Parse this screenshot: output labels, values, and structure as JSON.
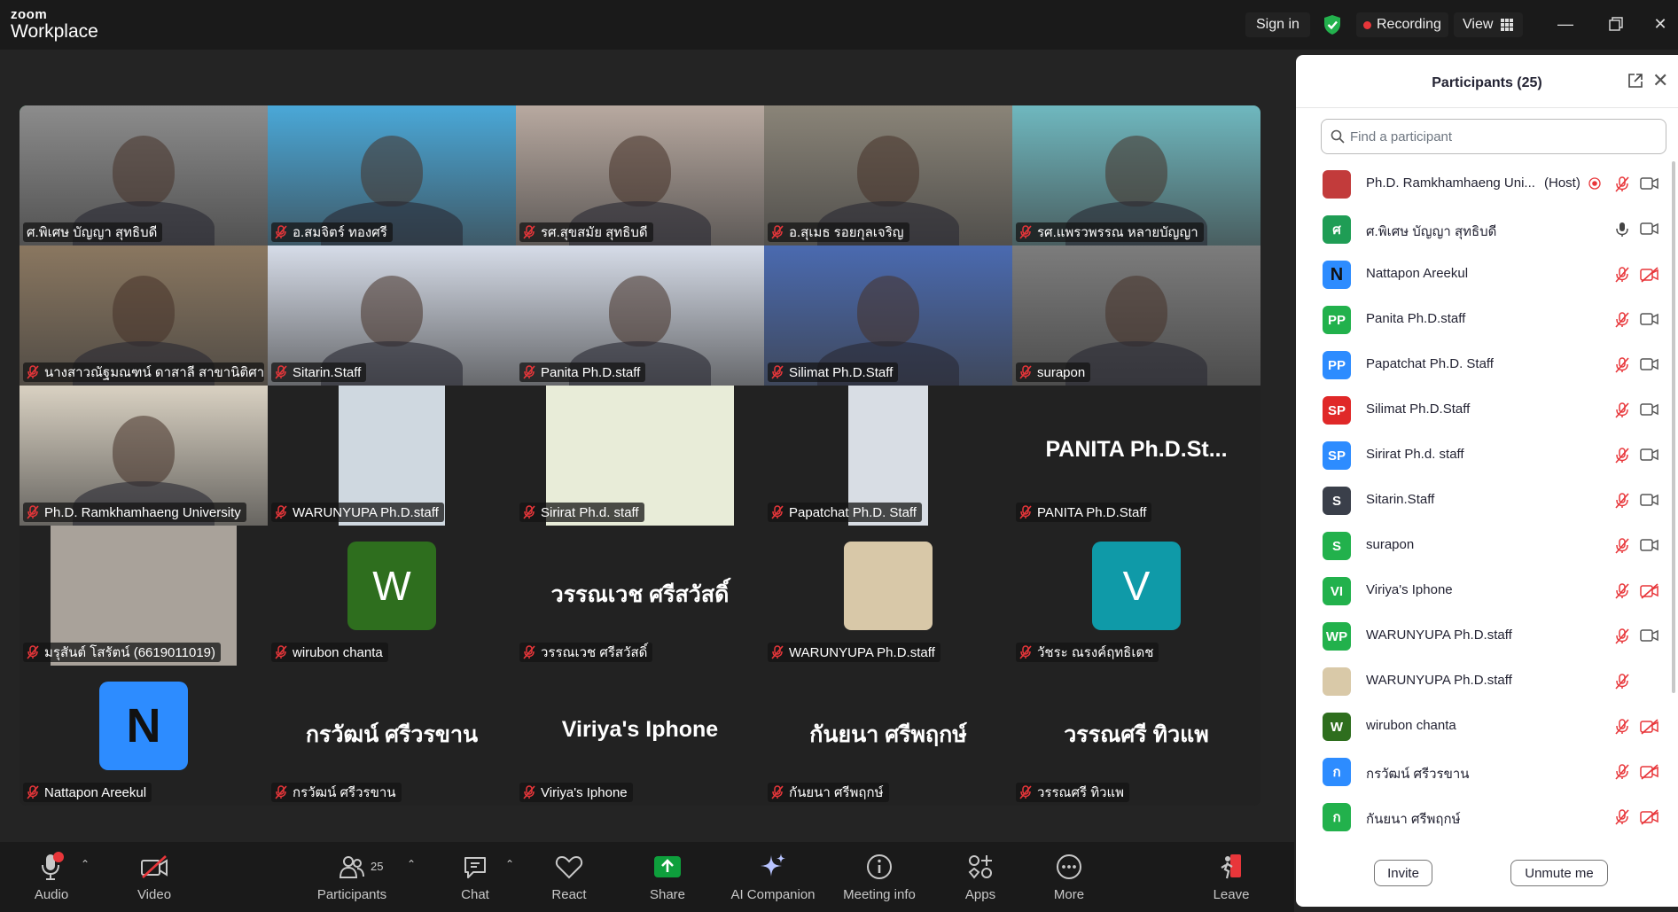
{
  "app": {
    "brand_top": "zoom",
    "brand_bottom": "Workplace"
  },
  "titlebar": {
    "sign_in": "Sign in",
    "recording": "Recording",
    "view": "View"
  },
  "grid": {
    "tiles": [
      {
        "label": "ศ.พิเศษ บัญญา สุทธิบดี",
        "muted": false,
        "active": true,
        "bg": "#8c8c8c",
        "kind": "video"
      },
      {
        "label": "อ.สมจิตร์ ทองศรี",
        "muted": true,
        "bg": "#4aa8d8",
        "kind": "video"
      },
      {
        "label": "รศ.สุขสมัย สุทธิบดี",
        "muted": true,
        "bg": "#b8a9a0",
        "kind": "video"
      },
      {
        "label": "อ.สุเมธ รอยกุลเจริญ",
        "muted": true,
        "bg": "#8a8478",
        "kind": "video"
      },
      {
        "label": "รศ.แพรวพรรณ หลายบัญญา",
        "muted": true,
        "bg": "#6fb8bf",
        "kind": "video"
      },
      {
        "label": "นางสาวณัฐมณฑน์ ดาสาลี สาขานิติศาส...",
        "muted": true,
        "bg": "#8a7760",
        "kind": "video"
      },
      {
        "label": "Sitarin.Staff",
        "muted": true,
        "bg": "#d6dce8",
        "kind": "video"
      },
      {
        "label": "Panita Ph.D.staff",
        "muted": true,
        "bg": "#d6dce8",
        "kind": "video"
      },
      {
        "label": "Silimat Ph.D.Staff",
        "muted": true,
        "bg": "#4a6ab0",
        "kind": "video"
      },
      {
        "label": "surapon",
        "muted": true,
        "bg": "#7c7c7c",
        "kind": "video"
      },
      {
        "label": "Ph.D. Ramkhamhaeng University",
        "muted": true,
        "bg": "#d9d1c2",
        "kind": "video"
      },
      {
        "label": "WARUNYUPA Ph.D.staff",
        "muted": true,
        "bg": "#cfd8e0",
        "kind": "narrow"
      },
      {
        "label": "Sirirat Ph.d. staff",
        "muted": true,
        "bg": "#e8ecd8",
        "kind": "narrow"
      },
      {
        "label": "Papatchat Ph.D. Staff",
        "muted": true,
        "bg": "#d8dde4",
        "kind": "narrow"
      },
      {
        "label": "PANITA Ph.D.Staff",
        "muted": true,
        "big": "PANITA  Ph.D.St...",
        "kind": "name"
      },
      {
        "label": "มรุสันต์ โสรัตน์ (6619011019)",
        "muted": true,
        "bg": "#a9a29a",
        "kind": "narrow"
      },
      {
        "label": "wirubon chanta",
        "muted": true,
        "avatar": "W",
        "avatar_bg": "#2e6e1e",
        "kind": "avatar"
      },
      {
        "label": "วรรณเวช ศรีสวัสดิ์",
        "muted": true,
        "big": "วรรณเวช ศรีสวัสดิ์",
        "kind": "name"
      },
      {
        "label": "WARUNYUPA Ph.D.staff",
        "muted": true,
        "bg": "#d8c8a8",
        "kind": "photo"
      },
      {
        "label": "วัชระ ณรงค์ฤทธิเดช",
        "muted": true,
        "avatar": "V",
        "avatar_bg": "#0f9aa8",
        "kind": "avatar"
      },
      {
        "label": "Nattapon Areekul",
        "muted": true,
        "avatar": "N",
        "avatar_bg": "#2d8cff",
        "kind": "avatarN"
      },
      {
        "label": "กรวัฒน์ ศรีวรขาน",
        "muted": true,
        "big": "กรวัฒน์ ศรีวรขาน",
        "kind": "name"
      },
      {
        "label": "Viriya's Iphone",
        "muted": true,
        "big": "Viriya's Iphone",
        "kind": "name"
      },
      {
        "label": "กันยนา ศรีพฤกษ์",
        "muted": true,
        "big": "กันยนา ศรีพฤกษ์",
        "kind": "name"
      },
      {
        "label": "วรรณศรี ทิวแพ",
        "muted": true,
        "big": "วรรณศรี  ทิวแพ",
        "kind": "name"
      }
    ]
  },
  "panel": {
    "title": "Participants (25)",
    "search_placeholder": "Find a participant",
    "invite": "Invite",
    "unmute_me": "Unmute me",
    "participants": [
      {
        "name": "Ph.D. Ramkhamhaeng Uni...",
        "host": "(Host)",
        "initials": "",
        "color": "#c23b3b",
        "mic": "muted",
        "cam": "on",
        "recording": true
      },
      {
        "name": "ศ.พิเศษ บัญญา สุทธิบดี",
        "initials": "ศ",
        "color": "#1f9d55",
        "mic": "on",
        "cam": "on"
      },
      {
        "name": "Nattapon Areekul",
        "initials": "N",
        "color": "#2d8cff",
        "mic": "muted",
        "cam": "off"
      },
      {
        "name": "Panita Ph.D.staff",
        "initials": "PP",
        "color": "#22b14c",
        "mic": "muted",
        "cam": "on"
      },
      {
        "name": "Papatchat Ph.D. Staff",
        "initials": "PP",
        "color": "#2d8cff",
        "mic": "muted",
        "cam": "on"
      },
      {
        "name": "Silimat Ph.D.Staff",
        "initials": "SP",
        "color": "#e02828",
        "mic": "muted",
        "cam": "on"
      },
      {
        "name": "Sirirat Ph.d. staff",
        "initials": "SP",
        "color": "#2d8cff",
        "mic": "muted",
        "cam": "on"
      },
      {
        "name": "Sitarin.Staff",
        "initials": "S",
        "color": "#3a3f4a",
        "mic": "muted",
        "cam": "on"
      },
      {
        "name": "surapon",
        "initials": "S",
        "color": "#22b14c",
        "mic": "muted",
        "cam": "on"
      },
      {
        "name": "Viriya's Iphone",
        "initials": "VI",
        "color": "#22b14c",
        "mic": "muted",
        "cam": "off"
      },
      {
        "name": "WARUNYUPA Ph.D.staff",
        "initials": "WP",
        "color": "#22b14c",
        "mic": "muted",
        "cam": "on"
      },
      {
        "name": "WARUNYUPA Ph.D.staff",
        "initials": "",
        "color": "#d9c9a8",
        "mic": "muted",
        "cam": "none"
      },
      {
        "name": "wirubon chanta",
        "initials": "W",
        "color": "#2e6e1e",
        "mic": "muted",
        "cam": "off"
      },
      {
        "name": "กรวัฒน์ ศรีวรขาน",
        "initials": "ก",
        "color": "#2d8cff",
        "mic": "muted",
        "cam": "off"
      },
      {
        "name": "กันยนา ศรีพฤกษ์",
        "initials": "ก",
        "color": "#22b14c",
        "mic": "muted",
        "cam": "off"
      }
    ]
  },
  "toolbar": {
    "audio": "Audio",
    "video": "Video",
    "participants": "Participants",
    "participants_count": "25",
    "chat": "Chat",
    "react": "React",
    "share": "Share",
    "ai_companion": "AI Companion",
    "meeting_info": "Meeting info",
    "apps": "Apps",
    "more": "More",
    "leave": "Leave"
  },
  "colors": {
    "accent_green": "#23d160",
    "muted_red": "#e8363a",
    "share_green": "#0e9f3c",
    "brand_blue": "#2d8cff"
  }
}
